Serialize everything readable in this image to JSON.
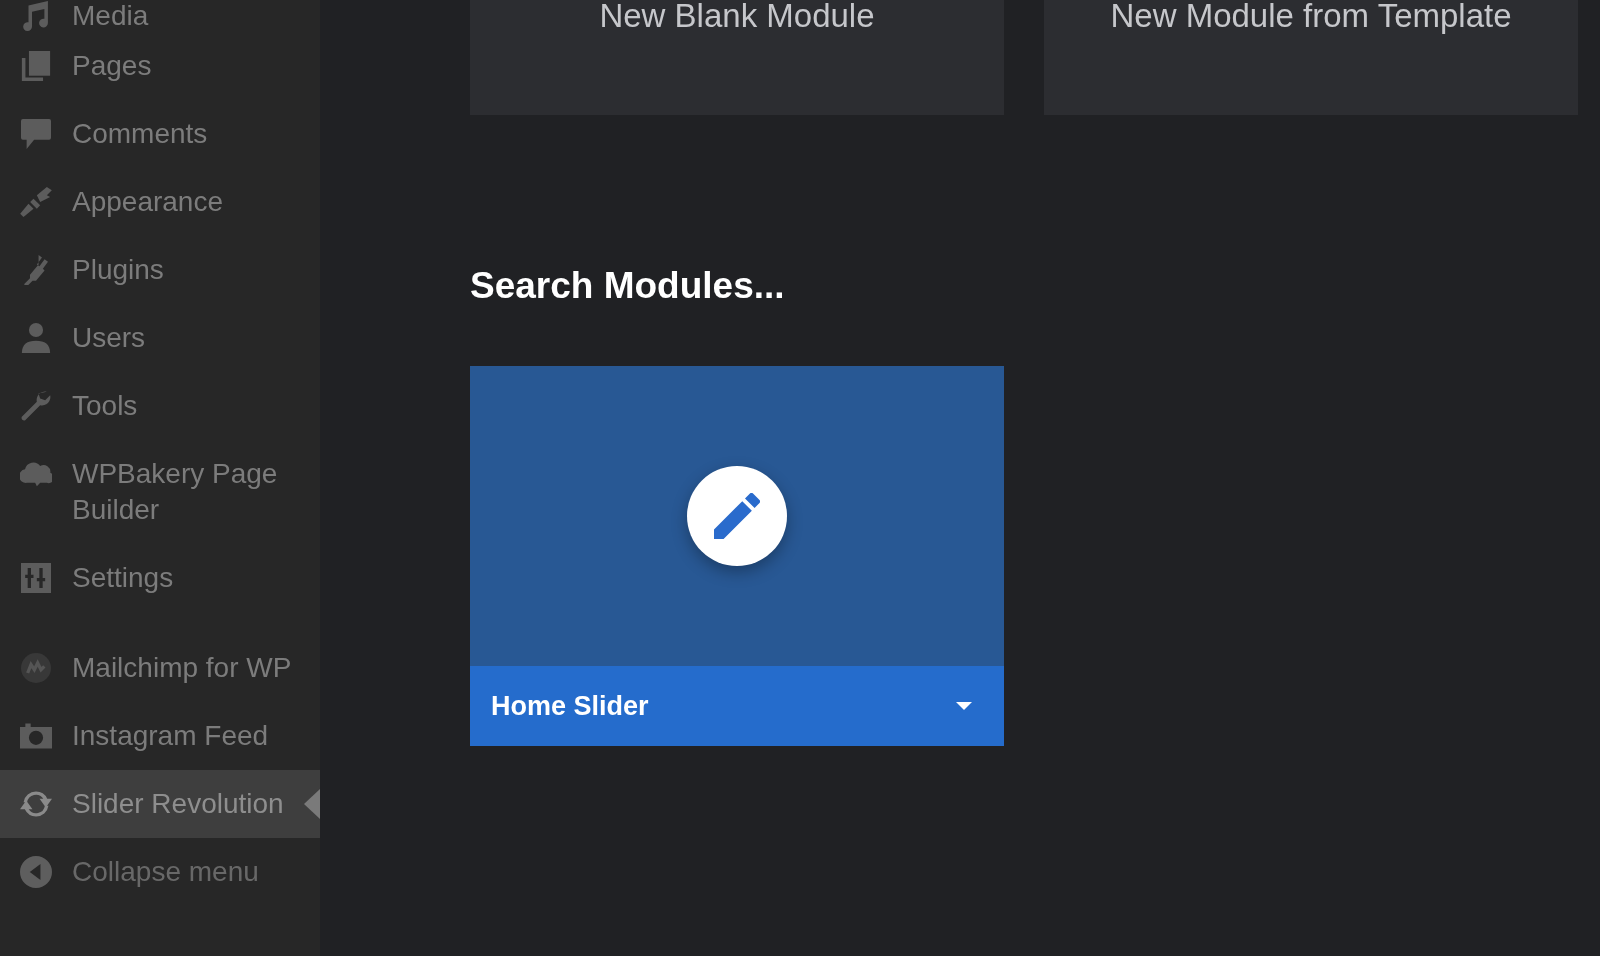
{
  "sidebar": {
    "sections": [
      {
        "items": [
          {
            "label": "Media",
            "selected": false
          },
          {
            "label": "Pages",
            "selected": false
          },
          {
            "label": "Comments",
            "selected": false
          },
          {
            "label": "Appearance",
            "selected": false
          },
          {
            "label": "Plugins",
            "selected": false
          },
          {
            "label": "Users",
            "selected": false
          },
          {
            "label": "Tools",
            "selected": false
          },
          {
            "label": "WPBakery Page Builder",
            "selected": false
          },
          {
            "label": "Settings",
            "selected": false
          }
        ]
      },
      {
        "items": [
          {
            "label": "Mailchimp for WP",
            "selected": false
          },
          {
            "label": "Instagram Feed",
            "selected": false
          },
          {
            "label": "Slider Revolution",
            "selected": true
          }
        ]
      }
    ],
    "collapse_menu": {
      "label": "Collapse menu"
    }
  },
  "main": {
    "create_cards": [
      {
        "label": "New Blank Module"
      },
      {
        "label": "New Module from Template"
      }
    ],
    "search": {
      "placeholder": "Search Modules..."
    },
    "modules": [
      {
        "title": "Home Slider"
      }
    ]
  }
}
